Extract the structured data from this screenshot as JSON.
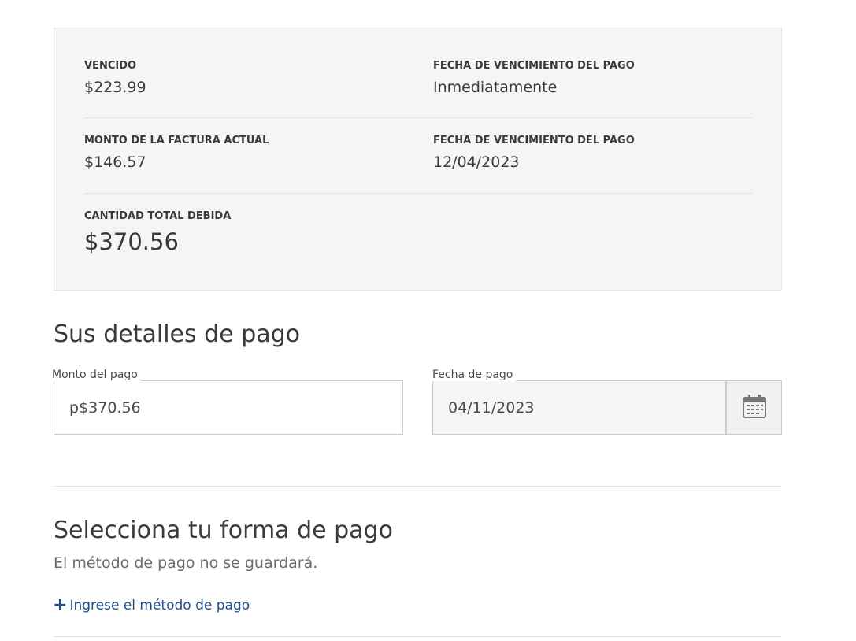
{
  "summary": {
    "rows": [
      {
        "left": {
          "label": "VENCIDO",
          "value": "$223.99"
        },
        "right": {
          "label": "FECHA DE VENCIMIENTO DEL PAGO",
          "value": "Inmediatamente"
        }
      },
      {
        "left": {
          "label": "MONTO DE LA FACTURA ACTUAL",
          "value": "$146.57"
        },
        "right": {
          "label": "FECHA DE VENCIMIENTO DEL PAGO",
          "value": "12/04/2023"
        }
      },
      {
        "left": {
          "label": "CANTIDAD TOTAL DEBIDA",
          "value": "$370.56"
        }
      }
    ]
  },
  "payment_details": {
    "title": "Sus detalles de pago",
    "amount_label": "Monto del pago",
    "amount_value": "p$370.56",
    "date_label": "Fecha de pago",
    "date_value": "04/11/2023",
    "calendar_icon": "calendar-icon"
  },
  "payment_method": {
    "title": "Selecciona tu forma de pago",
    "subtitle": "El método de pago no se guardará.",
    "add_link": "Ingrese el método de pago",
    "add_icon": "+"
  },
  "colors": {
    "summary_bg": "#f5f5f5",
    "link": "#1f4e8c",
    "text": "#3a3a3a"
  }
}
